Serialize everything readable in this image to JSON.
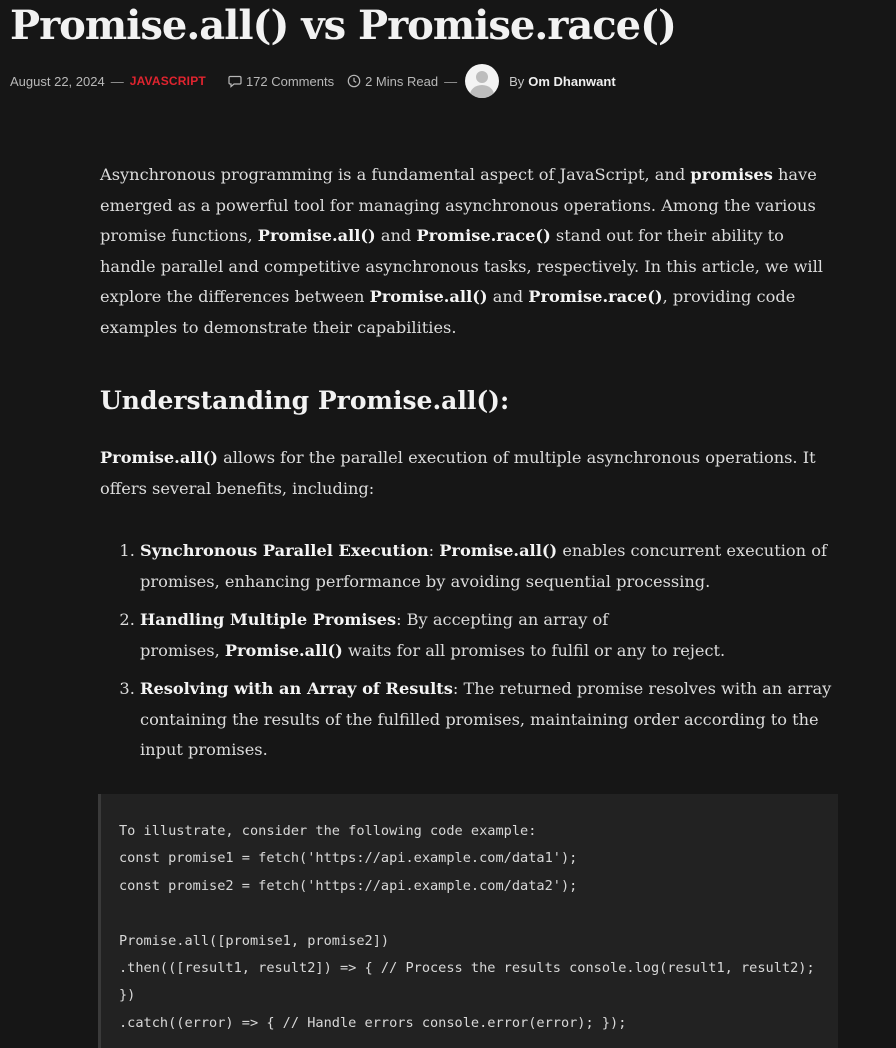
{
  "post": {
    "title": "Promise.all() vs Promise.race()",
    "meta": {
      "date": "August 22, 2024",
      "separator": "—",
      "category": "JAVASCRIPT",
      "comments": "172 Comments",
      "read_time": "2 Mins Read",
      "separator2": "—",
      "by": "By",
      "author": "Om Dhanwant"
    }
  },
  "article": {
    "intro": [
      {
        "t": "Asynchronous programming is a fundamental aspect of JavaScript, and "
      },
      {
        "b": "promises"
      },
      {
        "t": " have emerged as a powerful tool for managing asynchronous operations. Among the various promise functions, "
      },
      {
        "b": "Promise.all()"
      },
      {
        "t": " and "
      },
      {
        "b": "Promise.race()"
      },
      {
        "t": " stand out for their ability to handle parallel and competitive asynchronous tasks, respectively. In this article, we will explore the differences between "
      },
      {
        "b": "Promise.all()"
      },
      {
        "t": " and "
      },
      {
        "b": "Promise.race()"
      },
      {
        "t": ", providing code examples to demonstrate their capabilities."
      }
    ],
    "heading": "Understanding Promise.all():",
    "section_para": [
      {
        "b": "Promise.all()"
      },
      {
        "t": " allows for the parallel execution of multiple asynchronous operations. It offers several benefits, including:"
      }
    ],
    "benefits": [
      [
        {
          "b": "Synchronous Parallel Execution"
        },
        {
          "t": ": "
        },
        {
          "b": "Promise.all()"
        },
        {
          "t": " enables concurrent execution of promises, enhancing performance by avoiding sequential processing."
        }
      ],
      [
        {
          "b": "Handling Multiple Promises"
        },
        {
          "t": ": By accepting an array of"
        },
        {
          "br": true
        },
        {
          "t": "promises, "
        },
        {
          "b": "Promise.all()"
        },
        {
          "t": " waits for all promises to fulfil or any to reject."
        }
      ],
      [
        {
          "b": "Resolving with an Array of Results"
        },
        {
          "t": ": The returned promise resolves with an array containing the results of the fulfilled promises, maintaining order according to the input promises."
        }
      ]
    ],
    "code": "To illustrate, consider the following code example:\nconst promise1 = fetch('https://api.example.com/data1');\nconst promise2 = fetch('https://api.example.com/data2');\n\nPromise.all([promise1, promise2])\n.then(([result1, result2]) => { // Process the results console.log(result1, result2); })\n.catch((error) => { // Handle errors console.error(error); });"
  },
  "icons": {
    "comments": "speech-bubble-icon",
    "read_time": "clock-icon",
    "avatar": "user-avatar"
  },
  "colors": {
    "background": "#161616",
    "category": "#e0242f",
    "code_background": "#222222"
  }
}
